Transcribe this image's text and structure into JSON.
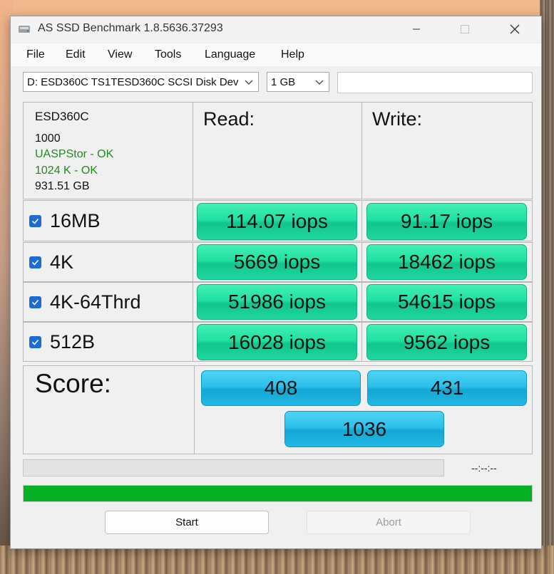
{
  "window": {
    "title": "AS SSD Benchmark 1.8.5636.37293"
  },
  "menu": {
    "items": [
      "File",
      "Edit",
      "View",
      "Tools",
      "Language",
      "Help"
    ]
  },
  "toolbar": {
    "drive_select_value": "D: ESD360C TS1TESD360C SCSI Disk Device",
    "size_select_value": "1 GB",
    "text_field_value": ""
  },
  "info": {
    "device_name": "ESD360C",
    "firmware": "1000",
    "driver_status": "UASPStor - OK",
    "alignment_status": "1024 K - OK",
    "capacity": "931.51 GB",
    "ok_color": "#208a20"
  },
  "headers": {
    "read": "Read:",
    "write": "Write:"
  },
  "tests": [
    {
      "label": "16MB",
      "checked": true,
      "read": "114.07 iops",
      "write": "91.17 iops"
    },
    {
      "label": "4K",
      "checked": true,
      "read": "5669 iops",
      "write": "18462 iops"
    },
    {
      "label": "4K-64Thrd",
      "checked": true,
      "read": "51986 iops",
      "write": "54615 iops"
    },
    {
      "label": "512B",
      "checked": true,
      "read": "16028 iops",
      "write": "9562 iops"
    }
  ],
  "score": {
    "label": "Score:",
    "read": "408",
    "write": "431",
    "total": "1036"
  },
  "status": {
    "time": "--:--:--",
    "progress_fraction": 1.0,
    "progress_color": "#06b025"
  },
  "buttons": {
    "start": "Start",
    "abort": "Abort"
  },
  "colors": {
    "result_green": "#22e0a3",
    "score_blue": "#2cc0ea",
    "checkbox_blue": "#1e6bd6"
  }
}
